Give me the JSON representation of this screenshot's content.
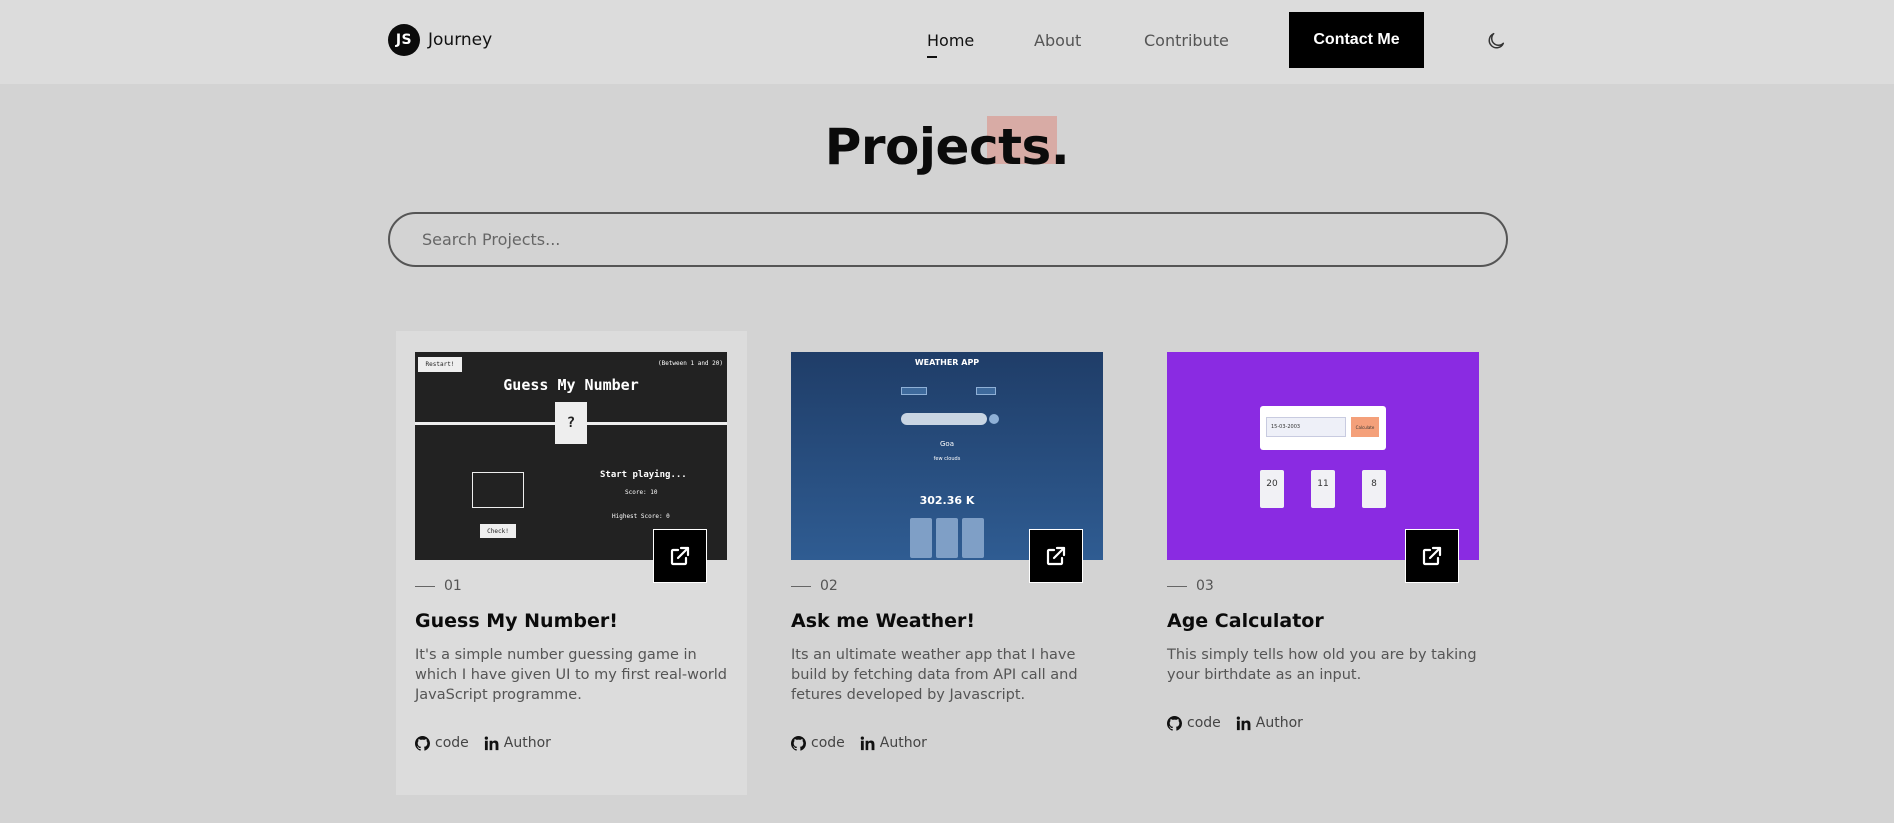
{
  "header": {
    "logo_initials": "JS",
    "logo_text": "Journey",
    "nav": {
      "home": "Home",
      "about": "About",
      "contribute": "Contribute"
    },
    "contact_button": "Contact Me",
    "theme_icon": "moon-icon"
  },
  "page": {
    "title": "Projects."
  },
  "search": {
    "placeholder": "Search Projects..."
  },
  "projects": [
    {
      "number": "01",
      "title": "Guess My Number!",
      "description": "It's a simple number guessing game in which I have given UI to my first real-world JavaScript programme.",
      "code_label": "code",
      "author_label": "Author",
      "preview": {
        "restart": "Restart!",
        "between": "(Between 1 and 20)",
        "heading": "Guess My Number",
        "mystery": "?",
        "check": "Check!",
        "status": "Start playing...",
        "score": "Score: 10",
        "highscore": "Highest Score: 0"
      }
    },
    {
      "number": "02",
      "title": "Ask me Weather!",
      "description": "Its an ultimate weather app that I have build by fetching data from API call and fetures developed by Javascript.",
      "code_label": "code",
      "author_label": "Author",
      "preview": {
        "heading": "WEATHER APP",
        "city": "Goa",
        "condition": "few clouds",
        "temp": "302.36 K"
      }
    },
    {
      "number": "03",
      "title": "Age Calculator",
      "description": "This simply tells how old you are by taking your birthdate as an input.",
      "code_label": "code",
      "author_label": "Author",
      "preview": {
        "date": "15-03-2003",
        "button": "Calculate",
        "years": "20",
        "months": "11",
        "days": "8"
      }
    }
  ],
  "colors": {
    "accent_highlight": "#d8aba5",
    "age_bg": "#8a2be2",
    "button_bg": "#000000"
  },
  "icons": [
    "external-link-icon",
    "github-icon",
    "linkedin-icon",
    "moon-icon"
  ]
}
